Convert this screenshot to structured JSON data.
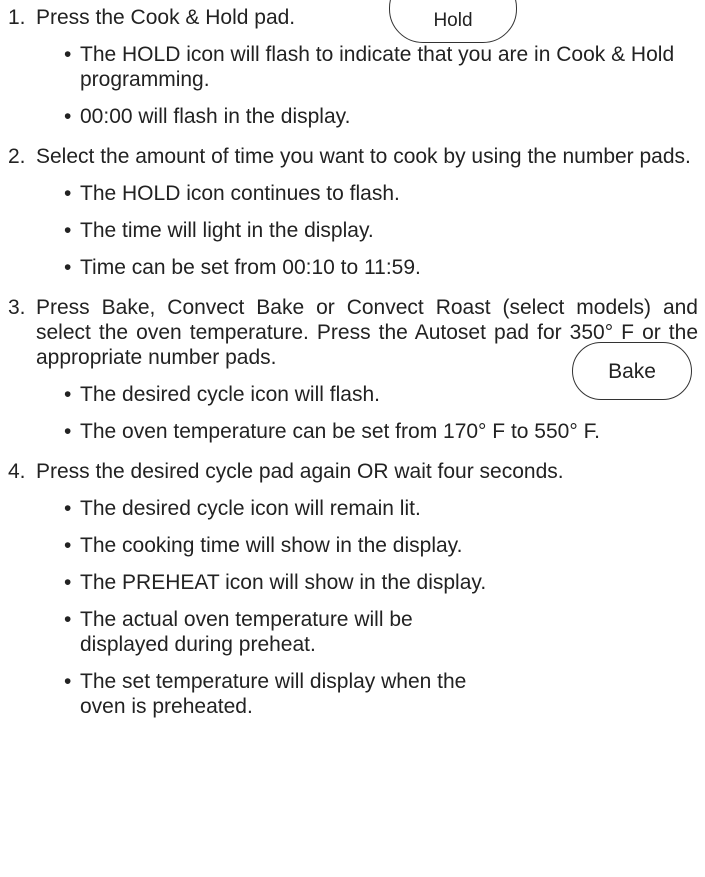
{
  "pads": {
    "hold_label": "Hold",
    "bake_label": "Bake"
  },
  "steps": [
    {
      "num": "1.",
      "text": "Press the Cook & Hold pad.",
      "bullets": [
        "The HOLD icon will flash to indicate that you are in Cook & Hold programming.",
        "00:00 will flash in the display."
      ]
    },
    {
      "num": "2.",
      "text": "Select the amount of time you want to cook by using the number pads.",
      "bullets": [
        "The HOLD icon continues to flash.",
        "The time will light in the display.",
        "Time can be set from 00:10 to 11:59."
      ]
    },
    {
      "num": "3.",
      "text": "Press Bake, Convect Bake or Convect Roast (select models) and select the oven temperature. Press the Autoset pad for 350° F or the appropriate number pads.",
      "bullets": [
        "The desired cycle icon will flash.",
        "The oven temperature can be set from 170° F to 550° F."
      ]
    },
    {
      "num": "4.",
      "text": "Press the desired cycle pad again OR wait four seconds.",
      "bullets": [
        "The desired cycle icon will remain lit.",
        "The cooking time will show in the display.",
        "The PREHEAT icon will show in the display.",
        "The actual oven temperature will be displayed during preheat.",
        "The set temperature will display when the oven is preheated."
      ]
    }
  ]
}
